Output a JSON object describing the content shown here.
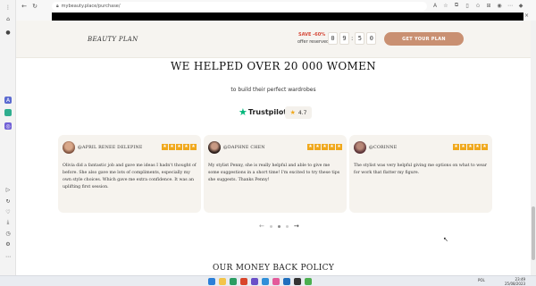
{
  "browser": {
    "url": "mybeauty.place/purchase/",
    "close_glyph": "×"
  },
  "promo": {
    "brand": "BEAUTY PLAN",
    "save_label": "SAVE -60%",
    "offer_label": "offer reserved:",
    "timer": {
      "m1": "0",
      "m2": "9",
      "s1": "5",
      "s2": "0"
    },
    "cta_label": "GET YOUR PLAN",
    "accent_color": "#c99072"
  },
  "hero": {
    "headline": "WE HELPED OVER 20 000 WOMEN",
    "subhead": "to build their perfect wardrobes"
  },
  "trustpilot": {
    "brand": "Trustpilot",
    "rating": "4.7",
    "brand_color": "#00b67a"
  },
  "reviews": [
    {
      "name": "@APRIL RENEE DELEPINE",
      "stars": 5,
      "text": "Olivia did a fantastic job and gave me ideas I hadn't thought of before. She also gave me lots of compliments, especially my own style choices. Which gave me extra confidence. It was an uplifting first session."
    },
    {
      "name": "@DAPHNE CHEN",
      "stars": 5,
      "text": "My stylist Penny, she is really helpful and able to give me some suggestions in a short time! I'm excited to try these tips she suggests. Thanks Penny!"
    },
    {
      "name": "@CORINNE",
      "stars": 5,
      "text": "The stylist was very helpful giving me options on what to wear for work that flatter my figure."
    }
  ],
  "carousel": {
    "prev": "←",
    "next": "→"
  },
  "next_section_heading": "OUR MONEY BACK POLICY",
  "taskbar": {
    "lang": "POL",
    "time": "23:49",
    "date": "25/08/2023"
  }
}
